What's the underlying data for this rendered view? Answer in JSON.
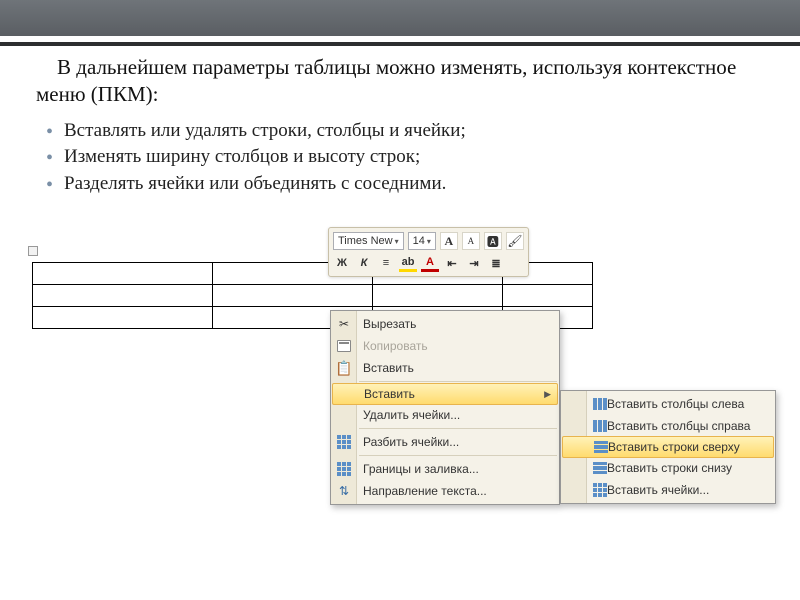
{
  "slide": {
    "heading": "В дальнейшем параметры таблицы можно изменять, используя контекстное меню (ПКМ):",
    "bullet1": "Вставлять или удалять строки, столбцы и ячейки;",
    "bullet2": "Изменять ширину столбцов и высоту строк;",
    "bullet3": "Разделять ячейки или объединять с соседними."
  },
  "minitoolbar": {
    "font_name": "Times New",
    "font_size": "14",
    "bold": "Ж",
    "italic": "К",
    "A_big": "A",
    "A_small": "A"
  },
  "context_menu": {
    "cut": "Вырезать",
    "copy": "Копировать",
    "paste": "Вставить",
    "insert": "Вставить",
    "delete_cells": "Удалить ячейки...",
    "split_cells": "Разбить ячейки...",
    "borders": "Границы и заливка...",
    "text_direction": "Направление текста..."
  },
  "submenu": {
    "cols_left": "Вставить столбцы слева",
    "cols_right": "Вставить столбцы справа",
    "rows_above": "Вставить строки сверху",
    "rows_below": "Вставить строки снизу",
    "insert_cells": "Вставить ячейки..."
  }
}
